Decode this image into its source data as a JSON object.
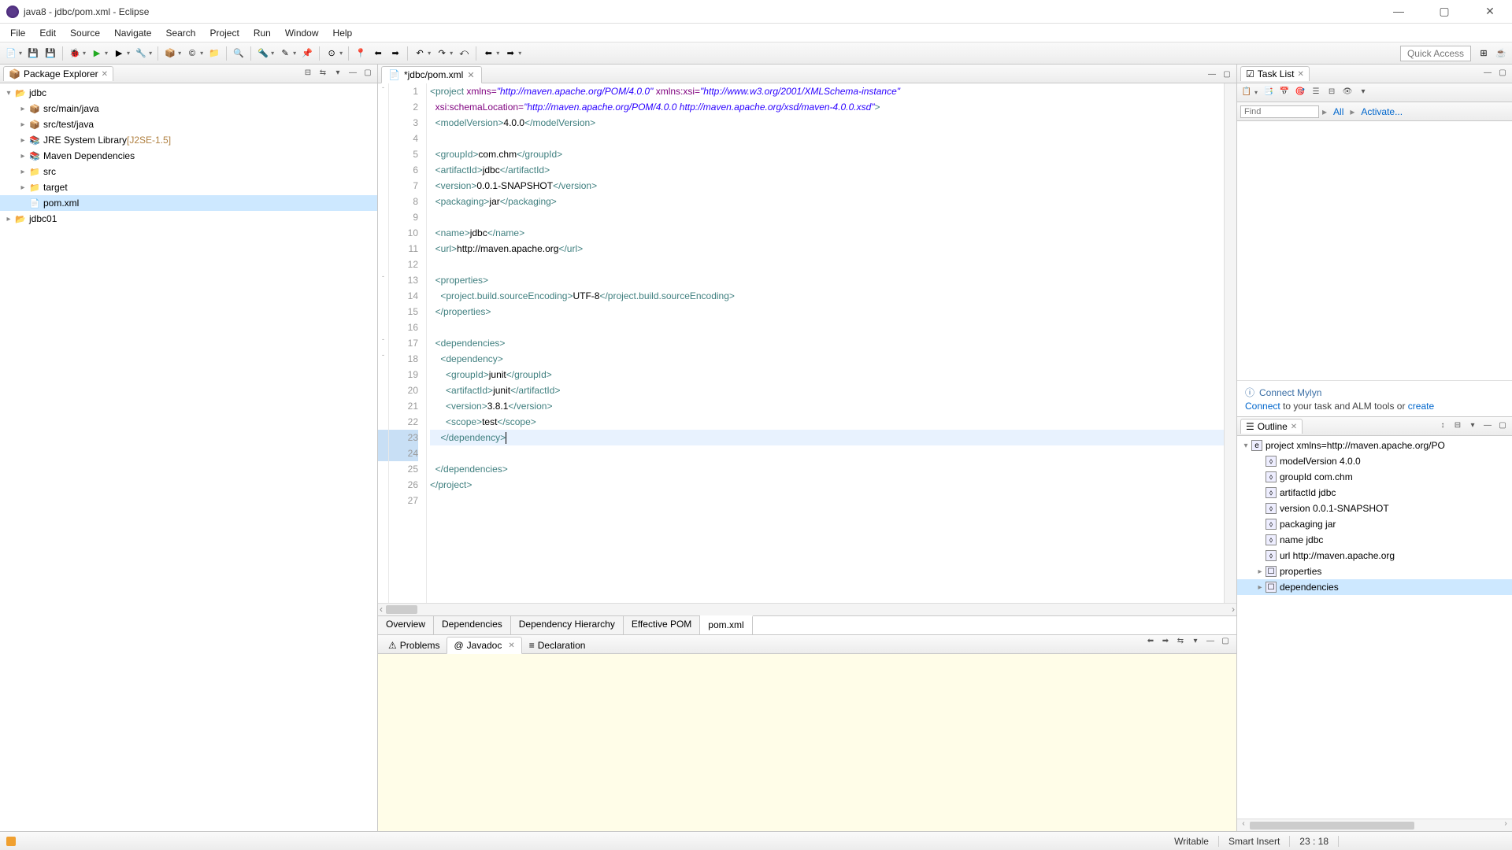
{
  "window": {
    "title": "java8 - jdbc/pom.xml - Eclipse"
  },
  "menu": [
    "File",
    "Edit",
    "Source",
    "Navigate",
    "Search",
    "Project",
    "Run",
    "Window",
    "Help"
  ],
  "quick_access": "Quick Access",
  "package_explorer": {
    "title": "Package Explorer",
    "tree": {
      "opened": "jdbc",
      "children": [
        {
          "icon": "📦",
          "label": "src/main/java"
        },
        {
          "icon": "📦",
          "label": "src/test/java"
        },
        {
          "icon": "📚",
          "label": "JRE System Library",
          "suffix": "[J2SE-1.5]"
        },
        {
          "icon": "📚",
          "label": "Maven Dependencies"
        },
        {
          "icon": "📁",
          "label": "src"
        },
        {
          "icon": "📁",
          "label": "target"
        },
        {
          "icon": "📄",
          "label": "pom.xml",
          "selected": true
        }
      ],
      "second": "jdbc01"
    }
  },
  "editor": {
    "tab": "*jdbc/pom.xml",
    "lines": [
      {
        "n": 1,
        "seg": [
          [
            "tag",
            "<project"
          ],
          [
            "txt",
            " "
          ],
          [
            "attr",
            "xmlns="
          ],
          [
            "str",
            "\"http://maven.apache.org/POM/4.0.0\""
          ],
          [
            "txt",
            " "
          ],
          [
            "attr",
            "xmlns:xsi="
          ],
          [
            "str",
            "\"http://www.w3.org/2001/XMLSchema-instance\""
          ]
        ],
        "fold": "-"
      },
      {
        "n": 2,
        "seg": [
          [
            "txt",
            "  "
          ],
          [
            "attr",
            "xsi:schemaLocation="
          ],
          [
            "str",
            "\"http://maven.apache.org/POM/4.0.0 http://maven.apache.org/xsd/maven-4.0.0.xsd\""
          ],
          [
            "tag",
            ">"
          ]
        ]
      },
      {
        "n": 3,
        "seg": [
          [
            "txt",
            "  "
          ],
          [
            "tag",
            "<modelVersion>"
          ],
          [
            "txt",
            "4.0.0"
          ],
          [
            "tag",
            "</modelVersion>"
          ]
        ]
      },
      {
        "n": 4,
        "seg": [
          [
            "txt",
            ""
          ]
        ]
      },
      {
        "n": 5,
        "seg": [
          [
            "txt",
            "  "
          ],
          [
            "tag",
            "<groupId>"
          ],
          [
            "txt",
            "com.chm"
          ],
          [
            "tag",
            "</groupId>"
          ]
        ]
      },
      {
        "n": 6,
        "seg": [
          [
            "txt",
            "  "
          ],
          [
            "tag",
            "<artifactId>"
          ],
          [
            "txt",
            "jdbc"
          ],
          [
            "tag",
            "</artifactId>"
          ]
        ]
      },
      {
        "n": 7,
        "seg": [
          [
            "txt",
            "  "
          ],
          [
            "tag",
            "<version>"
          ],
          [
            "txt",
            "0.0.1-SNAPSHOT"
          ],
          [
            "tag",
            "</version>"
          ]
        ]
      },
      {
        "n": 8,
        "seg": [
          [
            "txt",
            "  "
          ],
          [
            "tag",
            "<packaging>"
          ],
          [
            "txt",
            "jar"
          ],
          [
            "tag",
            "</packaging>"
          ]
        ]
      },
      {
        "n": 9,
        "seg": [
          [
            "txt",
            ""
          ]
        ]
      },
      {
        "n": 10,
        "seg": [
          [
            "txt",
            "  "
          ],
          [
            "tag",
            "<name>"
          ],
          [
            "txt",
            "jdbc"
          ],
          [
            "tag",
            "</name>"
          ]
        ]
      },
      {
        "n": 11,
        "seg": [
          [
            "txt",
            "  "
          ],
          [
            "tag",
            "<url>"
          ],
          [
            "txt",
            "http://maven.apache.org"
          ],
          [
            "tag",
            "</url>"
          ]
        ]
      },
      {
        "n": 12,
        "seg": [
          [
            "txt",
            ""
          ]
        ]
      },
      {
        "n": 13,
        "seg": [
          [
            "txt",
            "  "
          ],
          [
            "tag",
            "<properties>"
          ]
        ],
        "fold": "-"
      },
      {
        "n": 14,
        "seg": [
          [
            "txt",
            "    "
          ],
          [
            "tag",
            "<project.build.sourceEncoding>"
          ],
          [
            "txt",
            "UTF-8"
          ],
          [
            "tag",
            "</project.build.sourceEncoding>"
          ]
        ]
      },
      {
        "n": 15,
        "seg": [
          [
            "txt",
            "  "
          ],
          [
            "tag",
            "</properties>"
          ]
        ]
      },
      {
        "n": 16,
        "seg": [
          [
            "txt",
            ""
          ]
        ]
      },
      {
        "n": 17,
        "seg": [
          [
            "txt",
            "  "
          ],
          [
            "tag",
            "<dependencies>"
          ]
        ],
        "fold": "-"
      },
      {
        "n": 18,
        "seg": [
          [
            "txt",
            "    "
          ],
          [
            "tag",
            "<dependency>"
          ]
        ],
        "fold": "-"
      },
      {
        "n": 19,
        "seg": [
          [
            "txt",
            "      "
          ],
          [
            "tag",
            "<groupId>"
          ],
          [
            "txt",
            "junit"
          ],
          [
            "tag",
            "</groupId>"
          ]
        ]
      },
      {
        "n": 20,
        "seg": [
          [
            "txt",
            "      "
          ],
          [
            "tag",
            "<artifactId>"
          ],
          [
            "txt",
            "junit"
          ],
          [
            "tag",
            "</artifactId>"
          ]
        ]
      },
      {
        "n": 21,
        "seg": [
          [
            "txt",
            "      "
          ],
          [
            "tag",
            "<version>"
          ],
          [
            "txt",
            "3.8.1"
          ],
          [
            "tag",
            "</version>"
          ]
        ]
      },
      {
        "n": 22,
        "seg": [
          [
            "txt",
            "      "
          ],
          [
            "tag",
            "<scope>"
          ],
          [
            "txt",
            "test"
          ],
          [
            "tag",
            "</scope>"
          ]
        ]
      },
      {
        "n": 23,
        "seg": [
          [
            "txt",
            "    "
          ],
          [
            "tag",
            "</dependency>"
          ]
        ],
        "hl": true,
        "cursor": true
      },
      {
        "n": 24,
        "seg": [
          [
            "txt",
            ""
          ]
        ],
        "hl2": true
      },
      {
        "n": 25,
        "seg": [
          [
            "txt",
            "  "
          ],
          [
            "tag",
            "</dependencies>"
          ]
        ]
      },
      {
        "n": 26,
        "seg": [
          [
            "tag",
            "</project>"
          ]
        ]
      },
      {
        "n": 27,
        "seg": [
          [
            "txt",
            ""
          ]
        ]
      }
    ],
    "bottom_tabs": [
      "Overview",
      "Dependencies",
      "Dependency Hierarchy",
      "Effective POM",
      "pom.xml"
    ],
    "active_bottom": "pom.xml"
  },
  "bottom_view": {
    "tabs": [
      {
        "label": "Problems",
        "icon": "⚠"
      },
      {
        "label": "Javadoc",
        "icon": "@",
        "active": true
      },
      {
        "label": "Declaration",
        "icon": "≡"
      }
    ]
  },
  "tasklist": {
    "title": "Task List",
    "find": "Find",
    "all": "All",
    "activate": "Activate...",
    "mylyn_title": "Connect Mylyn",
    "mylyn_text_pre": "Connect",
    "mylyn_text_mid": " to your task and ALM tools or ",
    "mylyn_text_post": "create"
  },
  "outline": {
    "title": "Outline",
    "root": "project xmlns=http://maven.apache.org/PO",
    "items": [
      {
        "label": "modelVersion",
        "val": "4.0.0"
      },
      {
        "label": "groupId",
        "val": "com.chm"
      },
      {
        "label": "artifactId",
        "val": "jdbc"
      },
      {
        "label": "version",
        "val": "0.0.1-SNAPSHOT"
      },
      {
        "label": "packaging",
        "val": "jar"
      },
      {
        "label": "name",
        "val": "jdbc"
      },
      {
        "label": "url",
        "val": "http://maven.apache.org"
      },
      {
        "label": "properties",
        "expandable": true
      },
      {
        "label": "dependencies",
        "expandable": true,
        "selected": true
      }
    ]
  },
  "status": {
    "writable": "Writable",
    "insert": "Smart Insert",
    "pos": "23 : 18"
  }
}
